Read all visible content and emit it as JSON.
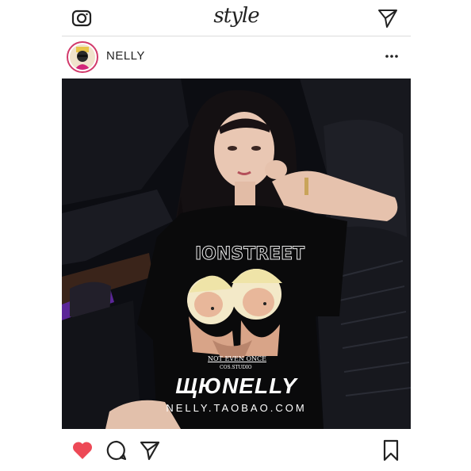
{
  "header": {
    "logo_text": "style",
    "camera_icon": "camera-icon",
    "send_icon": "paper-plane-icon"
  },
  "post": {
    "username": "NELLY",
    "more_icon": "more-dots-icon",
    "avatar_icon": "avatar-cartoon",
    "photo": {
      "shirt_print_line1": "NOT EVEN ONCE",
      "shirt_print_line2": "COS.STUDIO",
      "watermark_brand": "ЩЮNELLY",
      "watermark_url": "NELLY.TAOBAO.COM"
    }
  },
  "actions": {
    "like_icon": "heart-filled-icon",
    "comment_icon": "comment-bubble-icon",
    "share_icon": "paper-plane-icon",
    "save_icon": "bookmark-icon",
    "like_color": "#ed4956"
  }
}
